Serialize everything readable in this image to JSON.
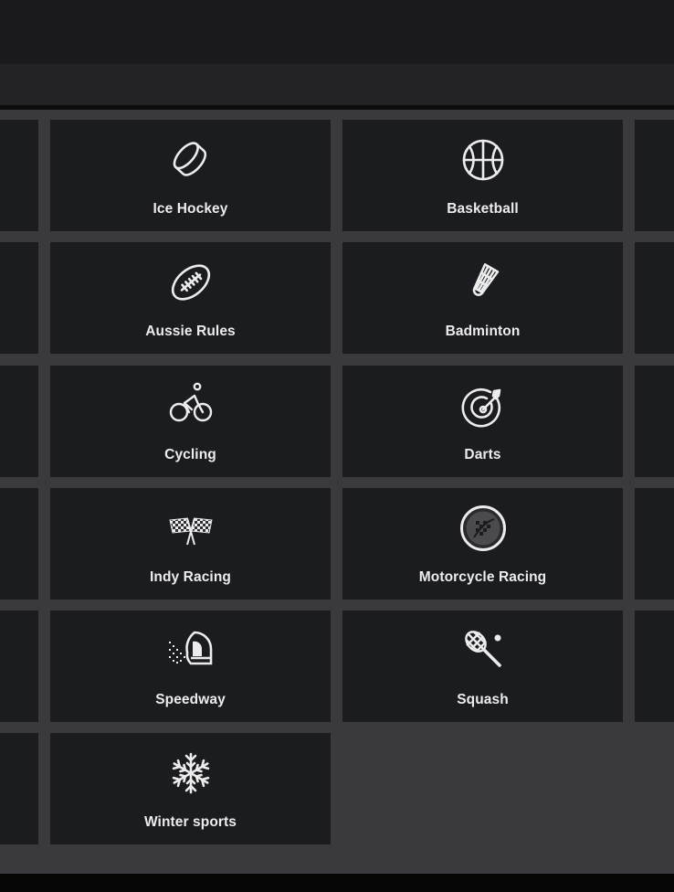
{
  "sports": [
    {
      "label": "Ice Hockey",
      "icon": "hockey-puck-icon"
    },
    {
      "label": "Basketball",
      "icon": "basketball-icon"
    },
    {
      "label": "Aussie Rules",
      "icon": "aussie-rules-ball-icon"
    },
    {
      "label": "Badminton",
      "icon": "shuttlecock-icon"
    },
    {
      "label": "Cycling",
      "icon": "cyclist-icon"
    },
    {
      "label": "Darts",
      "icon": "dartboard-icon"
    },
    {
      "label": "Indy Racing",
      "icon": "checkered-flags-icon"
    },
    {
      "label": "Motorcycle Racing",
      "icon": "race-badge-icon"
    },
    {
      "label": "Speedway",
      "icon": "helmet-icon"
    },
    {
      "label": "Squash",
      "icon": "squash-racket-icon"
    },
    {
      "label": "Winter sports",
      "icon": "snowflake-icon"
    }
  ],
  "colors": {
    "tile": "#1b1c20",
    "gap": "#3a3a3e",
    "text": "#ececec"
  }
}
